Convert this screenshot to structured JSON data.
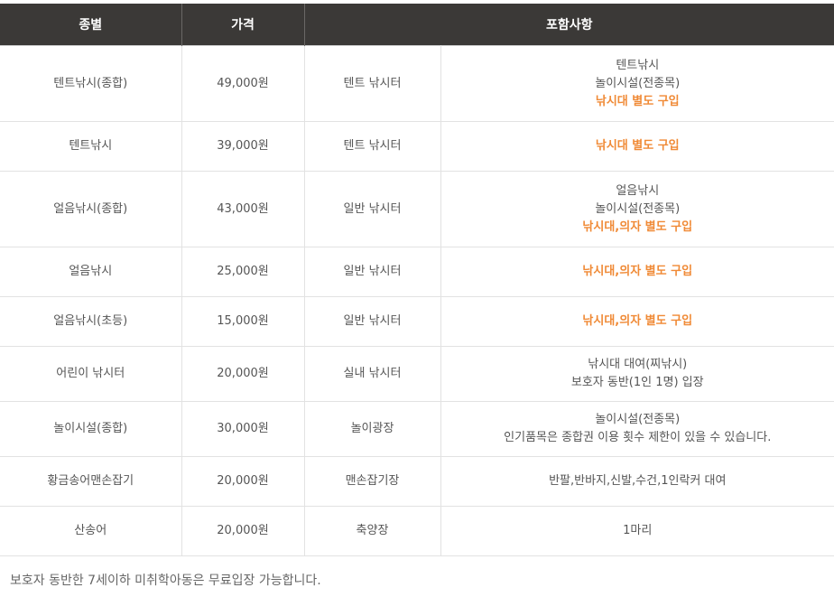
{
  "table": {
    "headers": {
      "type": "종별",
      "price": "가격",
      "includes": "포함사항"
    },
    "rows": [
      {
        "type": "텐트낚시(종합)",
        "price": "49,000원",
        "place": "텐트 낚시터",
        "notes": [
          {
            "text": "텐트낚시",
            "hl": false
          },
          {
            "text": "놀이시설(전종목)",
            "hl": false
          },
          {
            "text": "낚시대 별도 구입",
            "hl": true
          }
        ]
      },
      {
        "type": "텐트낚시",
        "price": "39,000원",
        "place": "텐트 낚시터",
        "notes": [
          {
            "text": "낚시대 별도 구입",
            "hl": true
          }
        ]
      },
      {
        "type": "얼음낚시(종합)",
        "price": "43,000원",
        "place": "일반 낚시터",
        "notes": [
          {
            "text": "얼음낚시",
            "hl": false
          },
          {
            "text": "놀이시설(전종목)",
            "hl": false
          },
          {
            "text": "낚시대,의자 별도 구입",
            "hl": true
          }
        ]
      },
      {
        "type": "얼음낚시",
        "price": "25,000원",
        "place": "일반 낚시터",
        "notes": [
          {
            "text": "낚시대,의자 별도 구입",
            "hl": true
          }
        ]
      },
      {
        "type": "얼음낚시(초등)",
        "price": "15,000원",
        "place": "일반 낚시터",
        "notes": [
          {
            "text": "낚시대,의자 별도 구입",
            "hl": true
          }
        ]
      },
      {
        "type": "어린이 낚시터",
        "price": "20,000원",
        "place": "실내 낚시터",
        "notes": [
          {
            "text": "낚시대 대여(찌낚시)",
            "hl": false
          },
          {
            "text": "보호자 동반(1인 1명) 입장",
            "hl": false
          }
        ]
      },
      {
        "type": "놀이시설(종합)",
        "price": "30,000원",
        "place": "놀이광장",
        "notes": [
          {
            "text": "놀이시설(전종목)",
            "hl": false
          },
          {
            "text": "인기품목은 종합권 이용 횟수 제한이 있을 수 있습니다.",
            "hl": false
          }
        ]
      },
      {
        "type": "황금송어맨손잡기",
        "price": "20,000원",
        "place": "맨손잡기장",
        "notes": [
          {
            "text": "반팔,반바지,신발,수건,1인락커 대여",
            "hl": false
          }
        ]
      },
      {
        "type": "산송어",
        "price": "20,000원",
        "place": "축양장",
        "notes": [
          {
            "text": "1마리",
            "hl": false
          }
        ]
      }
    ]
  },
  "footnote": "보호자 동반한 7세이하 미취학아동은 무료입장 가능합니다.",
  "colors": {
    "header_bg": "#3b3937",
    "highlight": "#f08a36",
    "text": "#555555",
    "border": "#e2e2e2"
  }
}
